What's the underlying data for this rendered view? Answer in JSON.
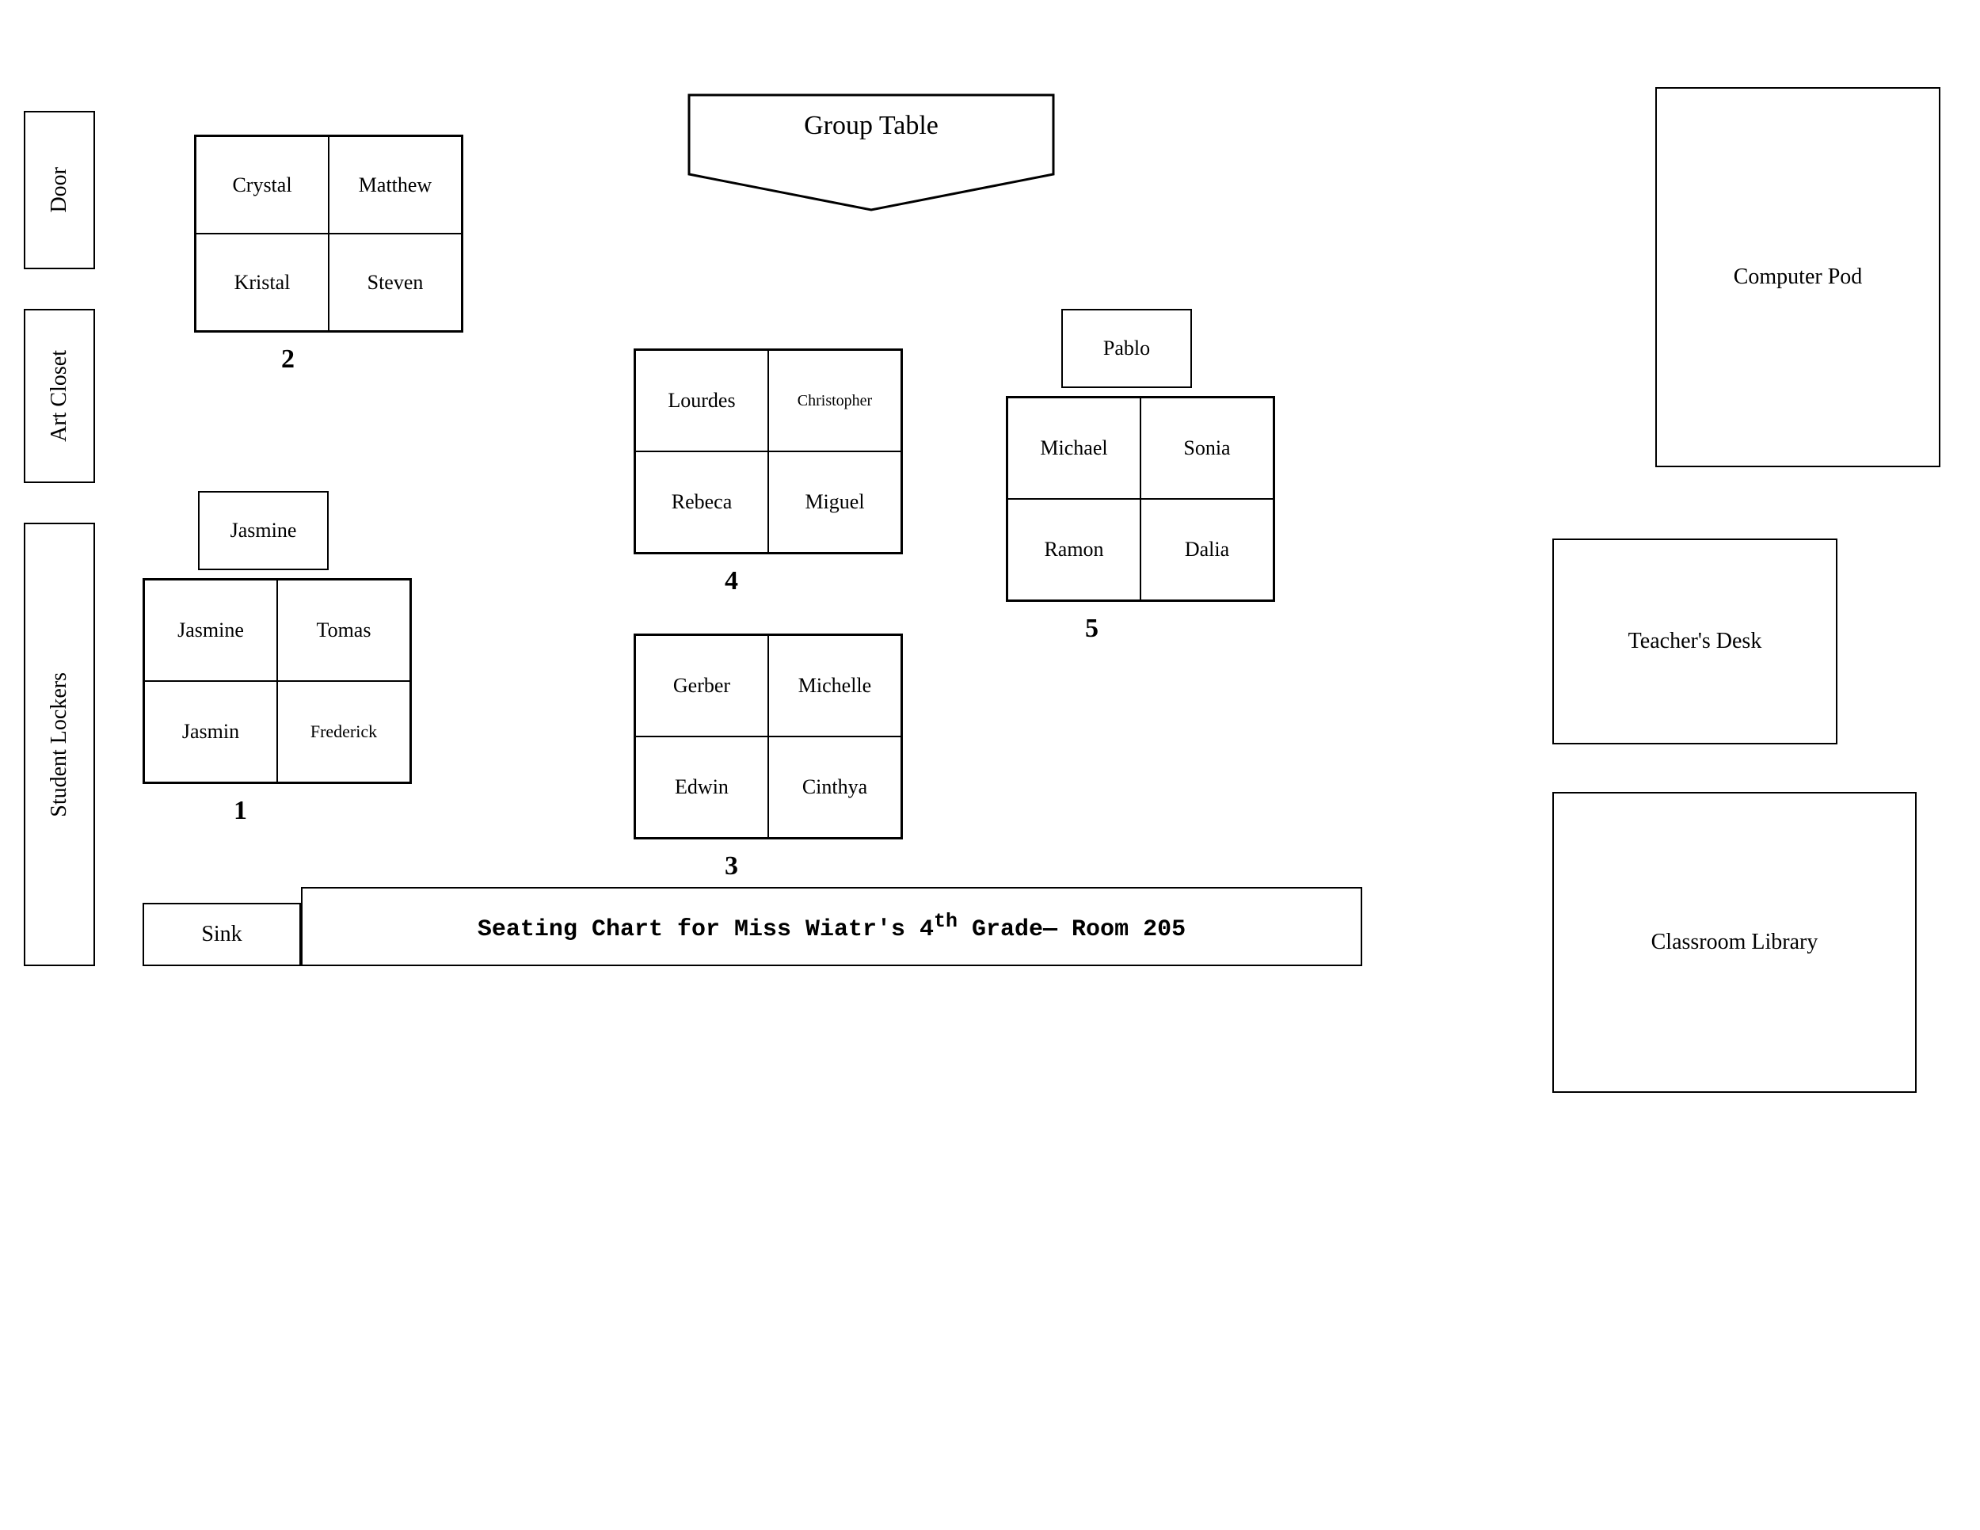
{
  "title": "Seating Chart for Miss Wiatr's 4th Grade— Room 205",
  "rooms": {
    "door": {
      "label": "Door"
    },
    "art_closet": {
      "label": "Art Closet"
    },
    "student_lockers": {
      "label": "Student Lockers"
    },
    "computer_pod": {
      "label": "Computer Pod"
    },
    "teachers_desk": {
      "label": "Teacher's Desk"
    },
    "classroom_library": {
      "label": "Classroom Library"
    },
    "group_table": {
      "label": "Group Table"
    },
    "sink": {
      "label": "Sink"
    }
  },
  "desk_groups": {
    "group1": {
      "number": "2",
      "students": [
        {
          "name": "Crystal",
          "row": 0,
          "col": 0
        },
        {
          "name": "Matthew",
          "row": 0,
          "col": 1
        },
        {
          "name": "Kristal",
          "row": 1,
          "col": 0
        },
        {
          "name": "Steven",
          "row": 1,
          "col": 1
        }
      ]
    },
    "group2": {
      "number": "1",
      "single_above": "Jasmine",
      "students": [
        {
          "name": "Jasmine",
          "row": 0,
          "col": 0
        },
        {
          "name": "Tomas",
          "row": 0,
          "col": 1
        },
        {
          "name": "Jasmin",
          "row": 1,
          "col": 0
        },
        {
          "name": "Frederick",
          "row": 1,
          "col": 1,
          "small": true
        }
      ]
    },
    "group3": {
      "number": "4",
      "students": [
        {
          "name": "Lourdes",
          "row": 0,
          "col": 0
        },
        {
          "name": "Christopher",
          "row": 0,
          "col": 1,
          "small": true
        },
        {
          "name": "Rebeca",
          "row": 1,
          "col": 0
        },
        {
          "name": "Miguel",
          "row": 1,
          "col": 1
        }
      ]
    },
    "group4": {
      "number": "3",
      "students": [
        {
          "name": "Gerber",
          "row": 0,
          "col": 0
        },
        {
          "name": "Michelle",
          "row": 0,
          "col": 1
        },
        {
          "name": "Edwin",
          "row": 1,
          "col": 0
        },
        {
          "name": "Cinthya",
          "row": 1,
          "col": 1
        }
      ]
    },
    "group5": {
      "number": "5",
      "single_above": "Pablo",
      "students": [
        {
          "name": "Michael",
          "row": 0,
          "col": 0
        },
        {
          "name": "Sonia",
          "row": 0,
          "col": 1
        },
        {
          "name": "Ramon",
          "row": 1,
          "col": 0
        },
        {
          "name": "Dalia",
          "row": 1,
          "col": 1
        }
      ]
    }
  }
}
